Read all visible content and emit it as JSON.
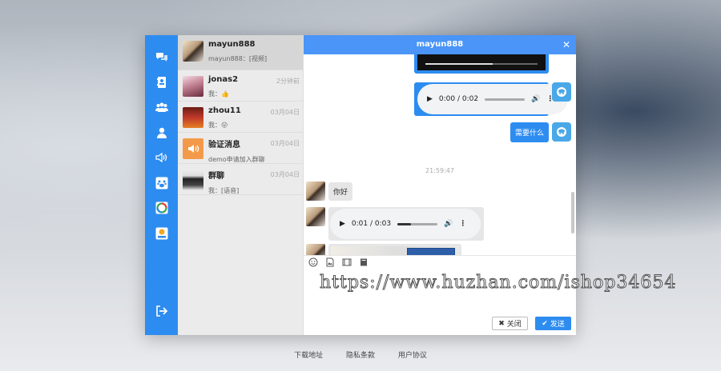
{
  "chat": {
    "title": "mayun888",
    "close_icon": "✕",
    "self_text_message": "需要什么",
    "timestamp": "21:59:47",
    "incoming_text": "你好",
    "audio_self": {
      "time": "0:00 / 0:02",
      "progress": 0.0
    },
    "audio_in": {
      "time": "0:01 / 0:03",
      "progress": 0.33
    }
  },
  "conversations": [
    {
      "name": "mayun888",
      "preview": "mayun888：[视频]",
      "time": "",
      "active": true
    },
    {
      "name": "jonas2",
      "preview": "我：👍",
      "time": "2分钟前"
    },
    {
      "name": "zhou11",
      "preview": "我：😛",
      "time": "03月04日"
    },
    {
      "name": "验证消息",
      "preview": "demo申请加入群聊",
      "time": "03月04日"
    },
    {
      "name": "群聊",
      "preview": "我：[语音]",
      "time": "03月04日"
    }
  ],
  "buttons": {
    "close": "关闭",
    "send": "发送"
  },
  "watermark": "https://www.huzhan.com/ishop34654",
  "footer": {
    "download": "下载地址",
    "privacy": "隐私条款",
    "agreement": "用户协议"
  },
  "colors": {
    "accent": "#2d8cf0",
    "header": "#4a95f7",
    "sidebar_bg": "#ebebeb"
  }
}
